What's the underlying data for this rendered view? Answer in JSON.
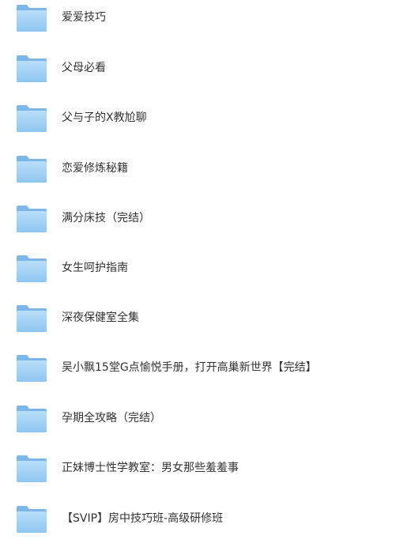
{
  "folders": [
    {
      "name": "爱爱技巧",
      "icon": "folder-icon"
    },
    {
      "name": "父母必看",
      "icon": "folder-icon"
    },
    {
      "name": "父与子的X教尬聊",
      "icon": "folder-icon"
    },
    {
      "name": "恋爱修炼秘籍",
      "icon": "folder-icon"
    },
    {
      "name": "满分床技（完结）",
      "icon": "folder-icon"
    },
    {
      "name": "女生呵护指南",
      "icon": "folder-icon"
    },
    {
      "name": "深夜保健室全集",
      "icon": "folder-icon"
    },
    {
      "name": "吴小飘15堂G点愉悦手册，打开高巢新世界【完结】",
      "icon": "folder-icon"
    },
    {
      "name": "孕期全攻略（完结）",
      "icon": "folder-icon"
    },
    {
      "name": "正妹博士性学教室：男女那些羞羞事",
      "icon": "folder-icon"
    },
    {
      "name": "【SVIP】房中技巧班-高级研修班",
      "icon": "folder-icon"
    }
  ],
  "colors": {
    "folder_back": "#8cc4f0",
    "folder_front": "#a9d6f8",
    "text": "#333333"
  }
}
